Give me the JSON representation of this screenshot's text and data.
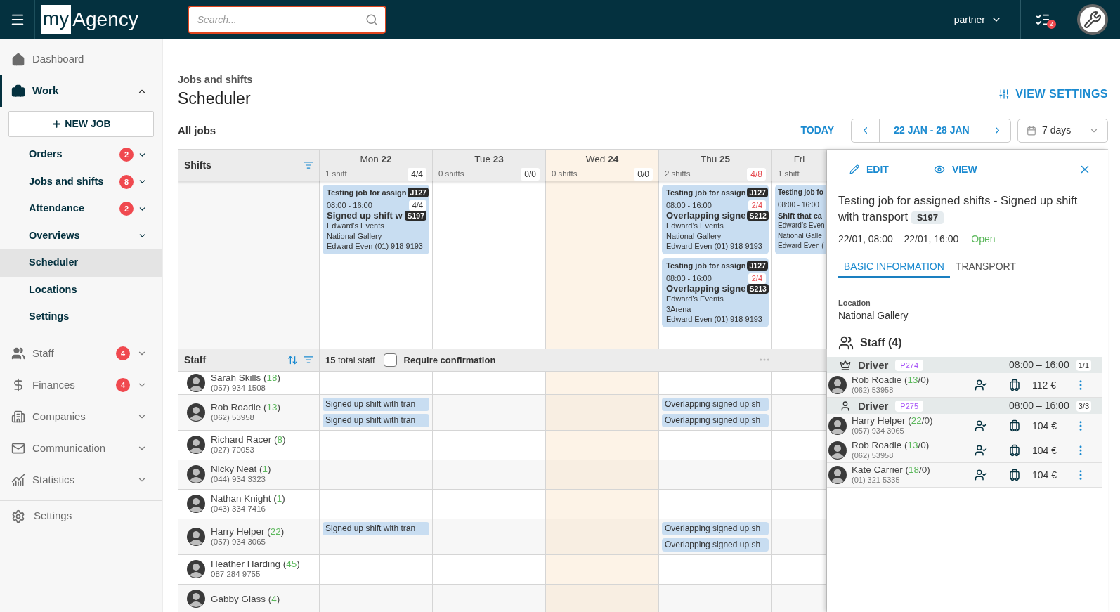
{
  "topbar": {
    "logo_box": "my",
    "logo_text": "Agency",
    "search": {
      "placeholder": "Search..."
    },
    "user": "partner",
    "tasks_badge": "2"
  },
  "sidebar": {
    "items": [
      {
        "kind": "link",
        "label": "Dashboard",
        "selected": false
      },
      {
        "kind": "group",
        "label": "Work",
        "expanded": true,
        "selected": true,
        "new_job": "NEW JOB",
        "children": [
          {
            "kind": "group",
            "label": "Orders",
            "badge": "2",
            "expanded": false,
            "selected": false
          },
          {
            "kind": "group",
            "label": "Jobs and shifts",
            "badge": "8",
            "expanded": false,
            "selected": false
          },
          {
            "kind": "group",
            "label": "Attendance",
            "badge": "2",
            "expanded": false,
            "selected": false
          },
          {
            "kind": "group",
            "label": "Overviews",
            "expanded": false,
            "selected": false
          },
          {
            "kind": "link",
            "label": "Scheduler",
            "selected": true
          },
          {
            "kind": "link",
            "label": "Locations",
            "selected": false
          },
          {
            "kind": "link",
            "label": "Settings",
            "selected": false
          }
        ]
      },
      {
        "kind": "group",
        "label": "Staff",
        "badge": "4",
        "expanded": false,
        "selected": false
      },
      {
        "kind": "group",
        "label": "Finances",
        "badge": "4",
        "expanded": false,
        "selected": false
      },
      {
        "kind": "group",
        "label": "Companies",
        "expanded": false,
        "selected": false
      },
      {
        "kind": "group",
        "label": "Communication",
        "expanded": false,
        "selected": false
      },
      {
        "kind": "group",
        "label": "Statistics",
        "expanded": false,
        "selected": false
      }
    ],
    "footer": {
      "label": "Settings"
    }
  },
  "page": {
    "breadcrumb": "Jobs and shifts",
    "title": "Scheduler",
    "view_settings": "VIEW SETTINGS",
    "filter_label": "All jobs",
    "today": "TODAY",
    "range": "22 JAN - 28 JAN",
    "period": "7 days"
  },
  "scheduler": {
    "shifts_header": "Shifts",
    "days": [
      {
        "weekday": "Mon",
        "date": "22",
        "shifts": "1 shift",
        "ratio": "4/4",
        "full": true,
        "today": false,
        "cards": [
          {
            "job": "Testing job for assign",
            "job_code": "J127",
            "time": "08:00 - 16:00",
            "ratio": "4/4",
            "full": true,
            "shift": "Signed up shift w",
            "shift_code": "S197",
            "lines": [
              "Edward’s Events",
              "National Gallery",
              "Edward Even (01) 918 9193"
            ]
          }
        ]
      },
      {
        "weekday": "Tue",
        "date": "23",
        "shifts": "0 shifts",
        "ratio": "0/0",
        "full": true,
        "today": false
      },
      {
        "weekday": "Wed",
        "date": "24",
        "shifts": "0 shifts",
        "ratio": "0/0",
        "full": true,
        "today": true
      },
      {
        "weekday": "Thu",
        "date": "25",
        "shifts": "2 shifts",
        "ratio": "4/8",
        "full": false,
        "today": false,
        "cards": [
          {
            "job": "Testing job for assign",
            "job_code": "J127",
            "time": "08:00 - 16:00",
            "ratio": "2/4",
            "full": false,
            "shift": "Overlapping signe",
            "shift_code": "S212",
            "lines": [
              "Edward’s Events",
              "National Gallery",
              "Edward Even (01) 918 9193"
            ]
          },
          {
            "job": "Testing job for assign",
            "job_code": "J127",
            "time": "08:00 - 16:00",
            "ratio": "2/4",
            "full": false,
            "shift": "Overlapping signe",
            "shift_code": "S213",
            "lines": [
              "Edward’s Events",
              "3Arena",
              "Edward Even (01) 918 9193"
            ]
          }
        ]
      },
      {
        "weekday": "Fri",
        "shifts": "1 shift",
        "today": false,
        "cards": [
          {
            "job": "Testing job fo",
            "time": "08:00 - 16:00",
            "shift": "Shift that ca",
            "lines": [
              "Edward’s Even",
              "National Galle",
              "Edward Even ("
            ]
          }
        ]
      }
    ],
    "staff_header": "Staff",
    "total": "15",
    "total_label": "total staff",
    "require": {
      "label": "Require confirmation",
      "checked": false
    },
    "staff": [
      {
        "name": "Sarah Skills",
        "count": {
          "before": "(",
          "value": "18",
          "after": ")"
        },
        "phone": "(057) 934 1508"
      },
      {
        "name": "Rob Roadie",
        "count": {
          "before": "(",
          "value": "13",
          "after": ")"
        },
        "phone": "(062) 53958",
        "cells": [
          {
            "chips": [
              "Signed up shift with tran",
              "Signed up shift with tran"
            ]
          },
          {},
          {},
          {
            "chips": [
              "Overlapping signed up sh",
              "Overlapping signed up sh"
            ]
          },
          {}
        ]
      },
      {
        "name": "Richard Racer",
        "count": {
          "before": "(",
          "value": "8",
          "after": ")"
        },
        "phone": "(027) 70053"
      },
      {
        "name": "Nicky Neat",
        "count": {
          "before": "(",
          "value": "1",
          "after": ")"
        },
        "phone": "(044) 934 3323"
      },
      {
        "name": "Nathan Knight",
        "count": {
          "before": "(",
          "value": "1",
          "after": ")"
        },
        "phone": "(043) 334 7416"
      },
      {
        "name": "Harry Helper",
        "count": {
          "before": "(",
          "value": "22",
          "after": ")"
        },
        "phone": "(057) 934 3065",
        "cells": [
          {
            "chips": [
              "Signed up shift with tran"
            ]
          },
          {},
          {},
          {
            "chips": [
              "Overlapping signed up sh",
              "Overlapping signed up sh"
            ]
          },
          {}
        ]
      },
      {
        "name": "Heather Harding",
        "count": {
          "before": "(",
          "value": "45",
          "after": ")"
        },
        "phone": "087 284 9755"
      },
      {
        "name": "Gabby Glass",
        "count": {
          "before": "(",
          "value": "4",
          "after": ")"
        }
      }
    ]
  },
  "panel": {
    "edit": "EDIT",
    "view": "VIEW",
    "title": "Testing job for assigned shifts - Signed up shift with transport",
    "code": "S197",
    "when": "22/01, 08:00 – 22/01, 16:00",
    "status": "Open",
    "tabs": [
      {
        "label": "BASIC INFORMATION",
        "selected": true
      },
      {
        "label": "TRANSPORT",
        "selected": false
      }
    ],
    "location_label": "Location",
    "location": "National Gallery",
    "staff_title": "Staff (4)",
    "positions": [
      {
        "kind": "leader",
        "role": "Driver",
        "code": "P274",
        "time": "08:00 – 16:00",
        "ratio": "1/1",
        "members": [
          {
            "name": "Rob Roadie",
            "count": {
              "before": "(",
              "value": "13",
              "after": "/0)"
            },
            "phone": "(062) 53958",
            "price": "112 €"
          }
        ]
      },
      {
        "kind": "member",
        "role": "Driver",
        "code": "P275",
        "time": "08:00 – 16:00",
        "ratio": "3/3",
        "members": [
          {
            "name": "Harry Helper",
            "count": {
              "before": "(",
              "value": "22",
              "after": "/0)"
            },
            "phone": "(057) 934 3065",
            "price": "104 €"
          },
          {
            "name": "Rob Roadie",
            "count": {
              "before": "(",
              "value": "13",
              "after": "/0)"
            },
            "phone": "(062) 53958",
            "price": "104 €"
          },
          {
            "name": "Kate Carrier",
            "count": {
              "before": "(",
              "value": "18",
              "after": "/0)"
            },
            "phone": "(01) 321 5335",
            "price": "104 €"
          }
        ]
      }
    ]
  }
}
